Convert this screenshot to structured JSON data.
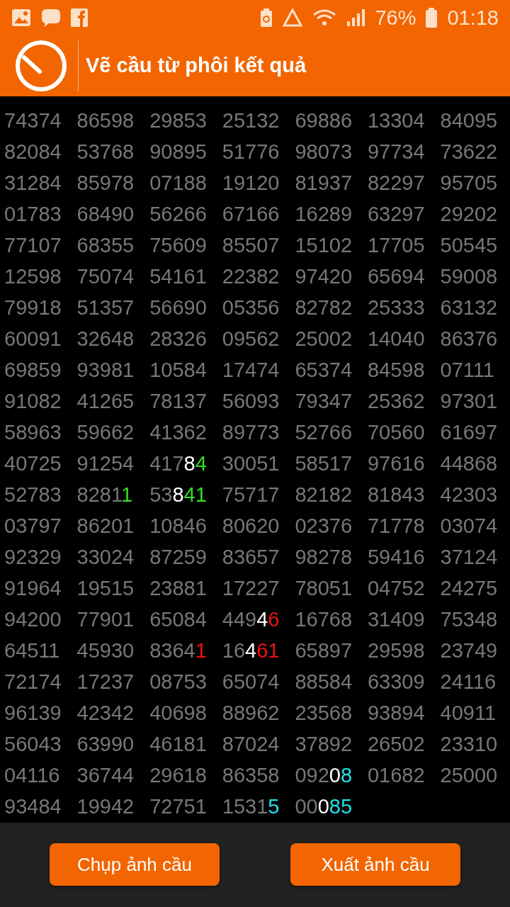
{
  "status_bar": {
    "battery": "76%",
    "time": "01:18"
  },
  "header": {
    "title": "Vẽ cầu từ phôi kết quả"
  },
  "grid": {
    "rows": [
      [
        "74374",
        "86598",
        "29853",
        "25132",
        "69886",
        "13304",
        "84095"
      ],
      [
        "82084",
        "53768",
        "90895",
        "51776",
        "98073",
        "97734",
        "73622"
      ],
      [
        "31284",
        "85978",
        "07188",
        "19120",
        "81937",
        "82297",
        "95705"
      ],
      [
        "01783",
        "68490",
        "56266",
        "67166",
        "16289",
        "63297",
        "29202"
      ],
      [
        "77107",
        "68355",
        "75609",
        "85507",
        "15102",
        "17705",
        "50545"
      ],
      [
        "12598",
        "75074",
        "54161",
        "22382",
        "97420",
        "65694",
        "59008"
      ],
      [
        "79918",
        "51357",
        "56690",
        "05356",
        "82782",
        "25333",
        "63132"
      ],
      [
        "60091",
        "32648",
        "28326",
        "09562",
        "25002",
        "14040",
        "86376"
      ],
      [
        "69859",
        "93981",
        "10584",
        "17474",
        "65374",
        "84598",
        "07111"
      ],
      [
        "91082",
        "41265",
        "78137",
        "56093",
        "79347",
        "25362",
        "97301"
      ],
      [
        "58963",
        "59662",
        "41362",
        "89773",
        "52766",
        "70560",
        "61697"
      ],
      [
        "40725",
        "91254",
        {
          "parts": [
            {
              "text": "417"
            },
            {
              "text": "8",
              "color": "#ffffff"
            },
            {
              "text": "4",
              "color": "#33dd22"
            }
          ]
        },
        "30051",
        "58517",
        "97616",
        "44868"
      ],
      [
        "52783",
        {
          "parts": [
            {
              "text": "8281"
            },
            {
              "text": "1",
              "color": "#33dd22"
            }
          ]
        },
        {
          "parts": [
            {
              "text": "53"
            },
            {
              "text": "8",
              "color": "#ffffff"
            },
            {
              "text": "41",
              "color": "#33dd22"
            }
          ]
        },
        "75717",
        "82182",
        "81843",
        "42303"
      ],
      [
        "03797",
        "86201",
        "10846",
        "80620",
        "02376",
        "71778",
        "03074"
      ],
      [
        "92329",
        "33024",
        "87259",
        "83657",
        "98278",
        "59416",
        "37124"
      ],
      [
        "91964",
        "19515",
        "23881",
        "17227",
        "78051",
        "04752",
        "24275"
      ],
      [
        "94200",
        "77901",
        "65084",
        {
          "parts": [
            {
              "text": "449"
            },
            {
              "text": "4",
              "color": "#ffffff"
            },
            {
              "text": "6",
              "color": "#ee1111"
            }
          ]
        },
        "16768",
        "31409",
        "75348"
      ],
      [
        "64511",
        "45930",
        {
          "parts": [
            {
              "text": "8364"
            },
            {
              "text": "1",
              "color": "#ee1111"
            }
          ]
        },
        {
          "parts": [
            {
              "text": "16"
            },
            {
              "text": "4",
              "color": "#ffffff"
            },
            {
              "text": "61",
              "color": "#ee1111"
            }
          ]
        },
        "65897",
        "29598",
        "23749"
      ],
      [
        "72174",
        "17237",
        "08753",
        "65074",
        "88584",
        "63309",
        "24116"
      ],
      [
        "96139",
        "42342",
        "40698",
        "88962",
        "23568",
        "93894",
        "40911"
      ],
      [
        "56043",
        "63990",
        "46181",
        "87024",
        "37892",
        "26502",
        "23310"
      ],
      [
        "04116",
        "36744",
        "29618",
        "86358",
        {
          "parts": [
            {
              "text": "092"
            },
            {
              "text": "0",
              "color": "#ffffff"
            },
            {
              "text": "8",
              "color": "#22e0e8"
            }
          ]
        },
        "01682",
        "25000"
      ],
      [
        "93484",
        "19942",
        "72751",
        {
          "parts": [
            {
              "text": "1531"
            },
            {
              "text": "5",
              "color": "#22e0e8"
            }
          ]
        },
        {
          "parts": [
            {
              "text": "00"
            },
            {
              "text": "0",
              "color": "#ffffff"
            },
            {
              "text": "85",
              "color": "#22e0e8"
            }
          ]
        }
      ]
    ]
  },
  "buttons": [
    "Chụp ảnh cầu",
    "Xuất ảnh cầu"
  ]
}
